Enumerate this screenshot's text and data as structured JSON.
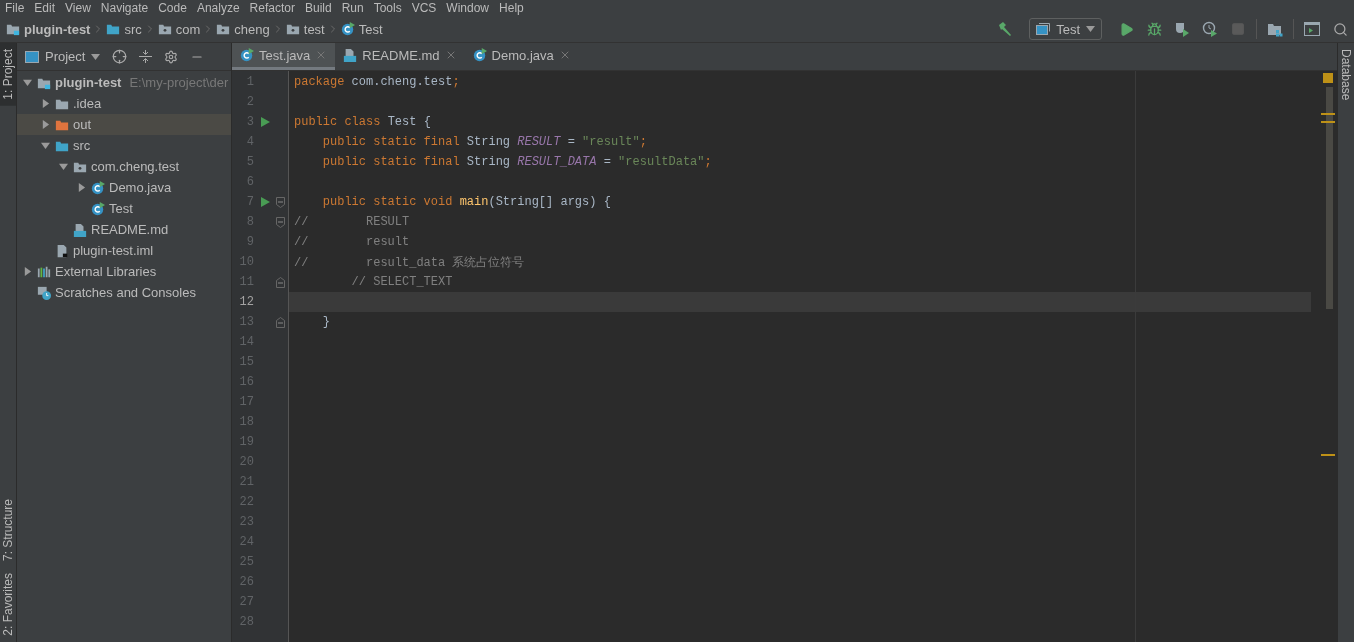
{
  "menu": [
    "File",
    "Edit",
    "View",
    "Navigate",
    "Code",
    "Analyze",
    "Refactor",
    "Build",
    "Run",
    "Tools",
    "VCS",
    "Window",
    "Help"
  ],
  "breadcrumbs": [
    {
      "label": "plugin-test",
      "kind": "module"
    },
    {
      "label": "src",
      "kind": "source"
    },
    {
      "label": "com",
      "kind": "package"
    },
    {
      "label": "cheng",
      "kind": "package"
    },
    {
      "label": "test",
      "kind": "package"
    },
    {
      "label": "Test",
      "kind": "class"
    }
  ],
  "run_config": {
    "label": "Test"
  },
  "left_strip": [
    "1: Project",
    "7: Structure",
    "2: Favorites"
  ],
  "right_strip": [
    "Database"
  ],
  "project_panel": {
    "title": "Project",
    "tree": [
      {
        "label": "plugin-test",
        "hint": "E:\\my-project\\der",
        "kind": "module",
        "expanded": true,
        "selected": false,
        "children": [
          {
            "label": ".idea",
            "kind": "folder",
            "expanded": false,
            "selected": false
          },
          {
            "label": "out",
            "kind": "excluded",
            "expanded": false,
            "selected": true
          },
          {
            "label": "src",
            "kind": "source",
            "expanded": true,
            "selected": false,
            "children": [
              {
                "label": "com.cheng.test",
                "kind": "package",
                "expanded": true,
                "selected": false,
                "children": [
                  {
                    "label": "Demo.java",
                    "kind": "class",
                    "expanded": false,
                    "selected": false
                  },
                  {
                    "label": "Test",
                    "kind": "class",
                    "selected": false
                  }
                ]
              },
              {
                "label": "README.md",
                "kind": "md",
                "selected": false
              }
            ]
          },
          {
            "label": "plugin-test.iml",
            "kind": "iml",
            "selected": false
          }
        ]
      },
      {
        "label": "External Libraries",
        "kind": "libraries",
        "expanded": false,
        "selected": false
      },
      {
        "label": "Scratches and Consoles",
        "kind": "scratches",
        "selected": false
      }
    ]
  },
  "tabs": [
    {
      "label": "Test.java",
      "kind": "class",
      "selected": true
    },
    {
      "label": "README.md",
      "kind": "md",
      "selected": false
    },
    {
      "label": "Demo.java",
      "kind": "class",
      "selected": false
    }
  ],
  "editor": {
    "lines": [
      {
        "number": "1",
        "tokens": [
          {
            "kind": "keyword",
            "text": "package "
          },
          {
            "kind": "plain",
            "text": "com.cheng.test"
          },
          {
            "kind": "keyword",
            "text": ";"
          }
        ]
      },
      {
        "number": "2"
      },
      {
        "number": "3",
        "run": true,
        "tokens": [
          {
            "kind": "keyword",
            "text": "public class "
          },
          {
            "kind": "plain",
            "text": "Test {"
          }
        ]
      },
      {
        "number": "4",
        "tokens": [
          {
            "kind": "keyword",
            "text": "    public static final "
          },
          {
            "kind": "plain",
            "text": "String "
          },
          {
            "kind": "constant",
            "text": "RESULT"
          },
          {
            "kind": "plain",
            "text": " = "
          },
          {
            "kind": "string",
            "text": "\"result\""
          },
          {
            "kind": "keyword",
            "text": ";"
          }
        ]
      },
      {
        "number": "5",
        "tokens": [
          {
            "kind": "keyword",
            "text": "    public static final "
          },
          {
            "kind": "plain",
            "text": "String "
          },
          {
            "kind": "constant",
            "text": "RESULT_DATA"
          },
          {
            "kind": "plain",
            "text": " = "
          },
          {
            "kind": "string",
            "text": "\"resultData\""
          },
          {
            "kind": "keyword",
            "text": ";"
          }
        ]
      },
      {
        "number": "6"
      },
      {
        "number": "7",
        "run": true,
        "fold_start": true,
        "tokens": [
          {
            "kind": "keyword",
            "text": "    public static void "
          },
          {
            "kind": "method",
            "text": "main"
          },
          {
            "kind": "plain",
            "text": "(String[] args) {"
          }
        ]
      },
      {
        "number": "8",
        "fold_start": true,
        "tokens": [
          {
            "kind": "comment",
            "text": "//        RESULT"
          }
        ]
      },
      {
        "number": "9",
        "tokens": [
          {
            "kind": "comment",
            "text": "//        result"
          }
        ]
      },
      {
        "number": "10",
        "tokens": [
          {
            "kind": "comment",
            "text": "//        result_data 系统占位符号"
          }
        ]
      },
      {
        "number": "11",
        "fold_end": true,
        "tokens": [
          {
            "kind": "comment",
            "text": "        // SELECT_TEXT"
          }
        ]
      },
      {
        "number": "12",
        "current": true
      },
      {
        "number": "13",
        "fold_end": true,
        "tokens": [
          {
            "kind": "plain",
            "text": "    }"
          }
        ]
      },
      {
        "number": "14"
      },
      {
        "number": "15"
      },
      {
        "number": "16"
      },
      {
        "number": "17"
      },
      {
        "number": "18"
      },
      {
        "number": "19"
      },
      {
        "number": "20"
      },
      {
        "number": "21"
      },
      {
        "number": "22"
      },
      {
        "number": "23"
      },
      {
        "number": "24"
      },
      {
        "number": "25"
      },
      {
        "number": "26"
      },
      {
        "number": "27"
      },
      {
        "number": "28"
      }
    ]
  }
}
